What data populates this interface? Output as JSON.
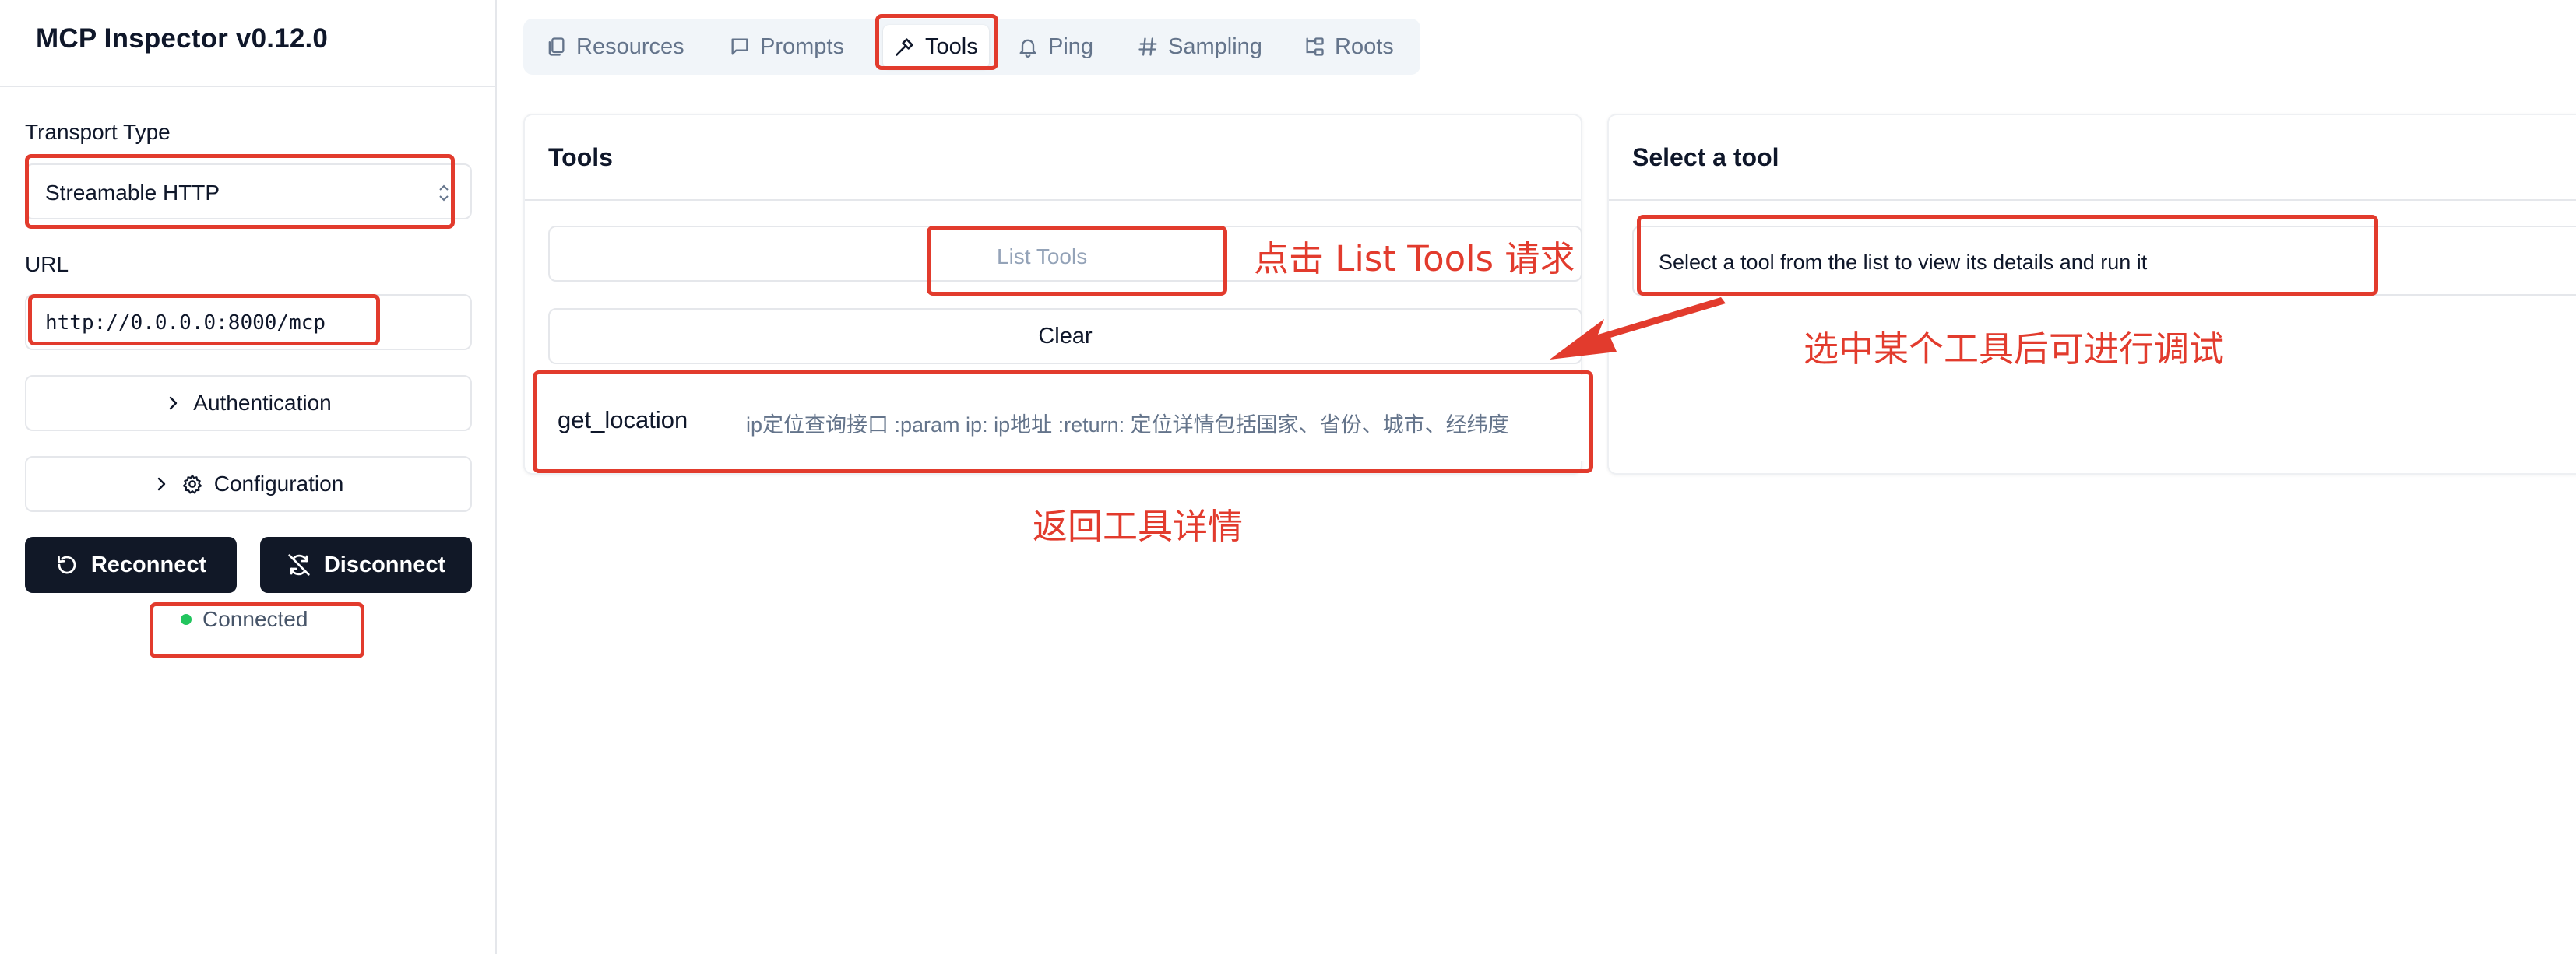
{
  "app": {
    "title": "MCP Inspector v0.12.0"
  },
  "sidebar": {
    "transport_label": "Transport Type",
    "transport_value": "Streamable HTTP",
    "url_label": "URL",
    "url_value": "http://0.0.0.0:8000/mcp",
    "authentication_label": "Authentication",
    "configuration_label": "Configuration",
    "reconnect_label": "Reconnect",
    "disconnect_label": "Disconnect",
    "status_text": "Connected",
    "status_color": "#22c55e"
  },
  "tabs": [
    {
      "label": "Resources",
      "icon": "files-icon",
      "active": false
    },
    {
      "label": "Prompts",
      "icon": "message-square-icon",
      "active": false
    },
    {
      "label": "Tools",
      "icon": "hammer-icon",
      "active": true
    },
    {
      "label": "Ping",
      "icon": "bell-icon",
      "active": false
    },
    {
      "label": "Sampling",
      "icon": "hash-icon",
      "active": false
    },
    {
      "label": "Roots",
      "icon": "folder-tree-icon",
      "active": false
    }
  ],
  "tools_panel": {
    "title": "Tools",
    "list_button": "List Tools",
    "clear_button": "Clear",
    "tools": [
      {
        "name": "get_location",
        "description": "ip定位查询接口 :param ip: ip地址 :return: 定位详情包括国家、省份、城市、经纬度"
      }
    ]
  },
  "detail_panel": {
    "title": "Select a tool",
    "placeholder": "Select a tool from the list to view its details and run it"
  },
  "annotations": {
    "list_tools_note": "点击 List Tools 请求",
    "select_tool_note": "选中某个工具后可进行调试",
    "return_note": "返回工具详情",
    "color": "#e23b2d"
  }
}
